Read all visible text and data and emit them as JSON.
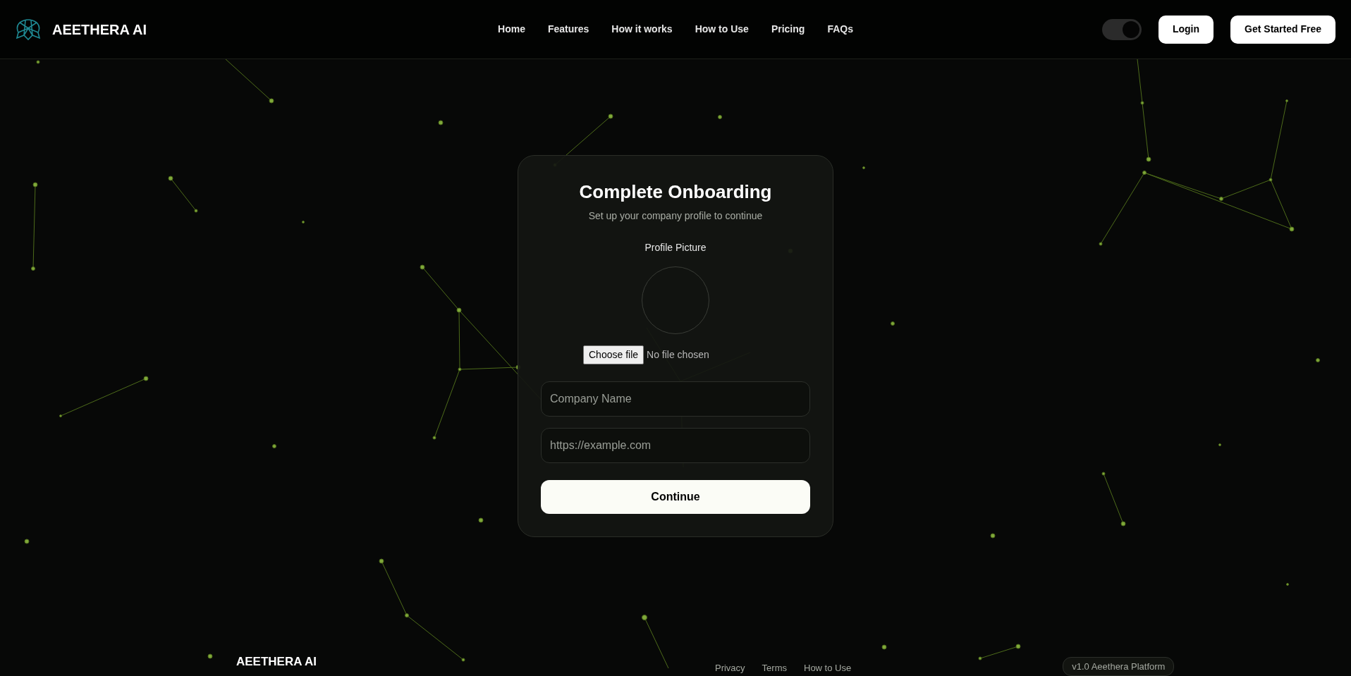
{
  "brand": {
    "name": "AEETHERA AI"
  },
  "nav": [
    {
      "label": "Home"
    },
    {
      "label": "Features"
    },
    {
      "label": "How it works"
    },
    {
      "label": "How to Use"
    },
    {
      "label": "Pricing"
    },
    {
      "label": "FAQs"
    }
  ],
  "theme_toggle": {
    "on": true
  },
  "header_buttons": [
    "Login",
    "Get Started Free"
  ],
  "card": {
    "title": "Complete Onboarding",
    "subtitle": "Set up your company profile to continue",
    "picture_label": "Profile Picture",
    "file_button": "Choose file",
    "file_status": "No file chosen",
    "fields": [
      {
        "placeholder": "Company Name"
      },
      {
        "placeholder": "https://example.com"
      }
    ],
    "submit": "Continue"
  },
  "footer": {
    "brand": "AEETHERA AI",
    "links": [
      "Privacy",
      "Terms",
      "How to Use"
    ],
    "version": "v1.0 Aeethera Platform"
  }
}
